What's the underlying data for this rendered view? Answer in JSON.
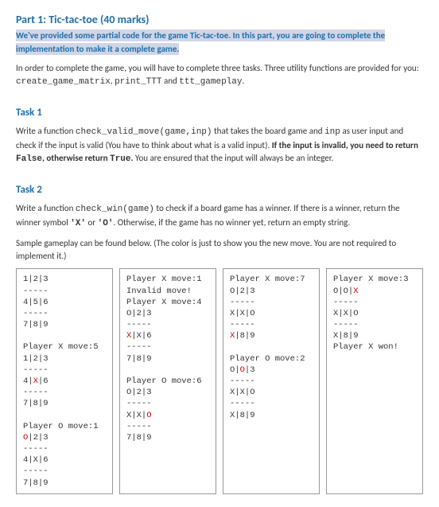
{
  "part": {
    "title": "Part 1: Tic-tac-toe (40 marks)",
    "highlight_line1": "We've provided some partial code for the game Tic-tac-toe. In this part, you are going to complete the",
    "highlight_line2": "implementation to make it a complete game.",
    "intro_a": "In order to complete the game, you will have to complete three tasks. Three utility functions are provided for you:",
    "intro_code1": "create_game_matrix",
    "intro_sep1": ", ",
    "intro_code2": "print_TTT",
    "intro_sep2": " and ",
    "intro_code3": "ttt_gameplay",
    "intro_end": "."
  },
  "task1": {
    "title": "Task 1",
    "text_a": "Write a function ",
    "code": "check_valid_move(game,inp)",
    "text_b": " that takes the board game and ",
    "code_inp": "inp",
    "text_c": " as user input and check if the input is valid (You have to think about what is a valid input). ",
    "bold1": "If the input is invalid, you need to return ",
    "bold_false": "False",
    "bold2": ", otherwise return ",
    "bold_true": "True",
    "bold3": ".",
    "text_d": " You are ensured that the input will always be an integer."
  },
  "task2": {
    "title": "Task 2",
    "text_a": "Write a function ",
    "code": "check_win(game)",
    "text_b": " to check if a board game has a winner. If there is a winner, return the winner symbol ",
    "sym_x": "'X'",
    "text_or": " or ",
    "sym_o": "'O'",
    "text_c": ". Otherwise, if the game has no winner yet, return an empty string.",
    "sample_note": "Sample gameplay can be found below.  (The color is just to show you the new move. You are not required to implement it.)"
  },
  "columns": {
    "col1": {
      "l1": "1|2|3",
      "l2": "-----",
      "l3": "4|5|6",
      "l4": "-----",
      "l5": "7|8|9",
      "l6": "",
      "l7": "Player X move:5",
      "l8": "1|2|3",
      "l9": "-----",
      "l10a": "4|",
      "l10b": "X",
      "l10c": "|6",
      "l11": "-----",
      "l12": "7|8|9",
      "l13": "",
      "l14": "Player O move:1",
      "l15a": "O",
      "l15b": "|2|3",
      "l16": "-----",
      "l17": "4|X|6",
      "l18": "-----",
      "l19": "7|8|9"
    },
    "col2": {
      "l1": "Player X move:1",
      "l2": "Invalid move!",
      "l3": "Player X move:4",
      "l4": "O|2|3",
      "l5": "-----",
      "l6a": "X",
      "l6b": "|X|6",
      "l7": "-----",
      "l8": "7|8|9",
      "l9": "",
      "l10": "Player O move:6",
      "l11": "O|2|3",
      "l12": "-----",
      "l13a": "X|X|",
      "l13b": "O",
      "l14": "-----",
      "l15": "7|8|9"
    },
    "col3": {
      "l1": "Player X move:7",
      "l2": "O|2|3",
      "l3": "-----",
      "l4": "X|X|O",
      "l5": "-----",
      "l6a": "X",
      "l6b": "|8|9",
      "l7": "",
      "l8": "Player O move:2",
      "l9a": "O|",
      "l9b": "O",
      "l9c": "|3",
      "l10": "-----",
      "l11": "X|X|O",
      "l12": "-----",
      "l13": "X|8|9"
    },
    "col4": {
      "l1": "Player X move:3",
      "l2a": "O|O|",
      "l2b": "X",
      "l3": "-----",
      "l4": "X|X|O",
      "l5": "-----",
      "l6": "X|8|9",
      "l7": "Player X won!"
    }
  }
}
